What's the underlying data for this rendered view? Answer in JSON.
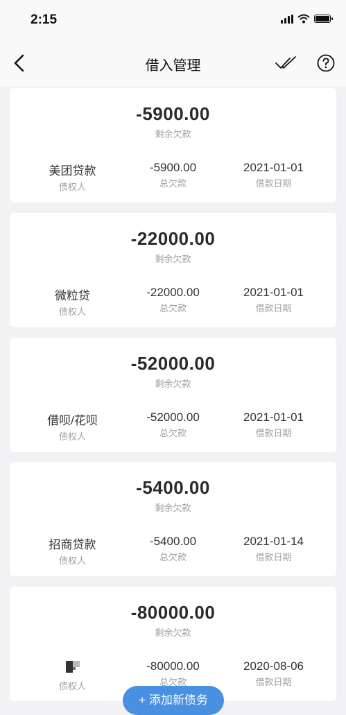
{
  "status_bar": {
    "time": "2:15"
  },
  "nav": {
    "title": "借入管理"
  },
  "debts": [
    {
      "remaining": "-5900.00",
      "remaining_label": "剩余欠款",
      "creditor": "美团贷款",
      "creditor_label": "债权人",
      "total": "-5900.00",
      "total_label": "总欠款",
      "date": "2021-01-01",
      "date_label": "借款日期"
    },
    {
      "remaining": "-22000.00",
      "remaining_label": "剩余欠款",
      "creditor": "微粒贷",
      "creditor_label": "债权人",
      "total": "-22000.00",
      "total_label": "总欠款",
      "date": "2021-01-01",
      "date_label": "借款日期"
    },
    {
      "remaining": "-52000.00",
      "remaining_label": "剩余欠款",
      "creditor": "借呗/花呗",
      "creditor_label": "债权人",
      "total": "-52000.00",
      "total_label": "总欠款",
      "date": "2021-01-01",
      "date_label": "借款日期"
    },
    {
      "remaining": "-5400.00",
      "remaining_label": "剩余欠款",
      "creditor": "招商贷款",
      "creditor_label": "债权人",
      "total": "-5400.00",
      "total_label": "总欠款",
      "date": "2021-01-14",
      "date_label": "借款日期"
    },
    {
      "remaining": "-80000.00",
      "remaining_label": "剩余欠款",
      "creditor": "",
      "creditor_label": "债权人",
      "total": "-80000.00",
      "total_label": "总欠款",
      "date": "2020-08-06",
      "date_label": "借款日期"
    }
  ],
  "add_button": {
    "label": "+ 添加新债务"
  },
  "colors": {
    "accent": "#4a90e2",
    "background": "#f2f2f4"
  }
}
